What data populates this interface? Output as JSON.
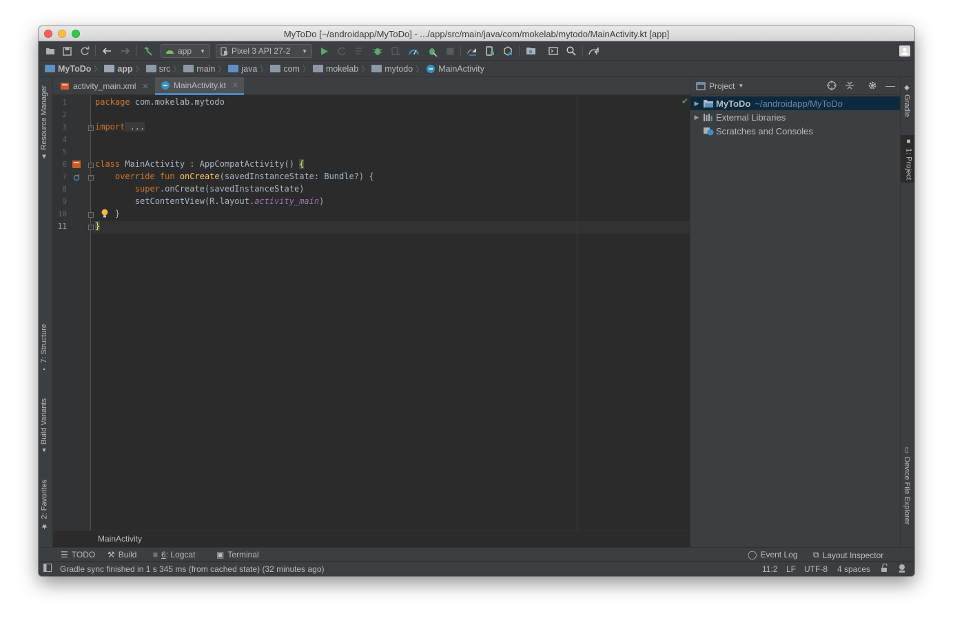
{
  "window": {
    "title": "MyToDo [~/androidapp/MyToDo] - .../app/src/main/java/com/mokelab/mytodo/MainActivity.kt [app]"
  },
  "toolbar": {
    "run_config": "app",
    "device": "Pixel 3 API 27-2"
  },
  "breadcrumb": [
    {
      "label": "MyToDo",
      "bold": true
    },
    {
      "label": "app",
      "bold": true
    },
    {
      "label": "src"
    },
    {
      "label": "main"
    },
    {
      "label": "java"
    },
    {
      "label": "com"
    },
    {
      "label": "mokelab"
    },
    {
      "label": "mytodo"
    },
    {
      "label": "MainActivity"
    }
  ],
  "left_tool_tabs": {
    "resource_manager": "Resource Manager",
    "structure": "7: Structure",
    "build_variants": "Build Variants",
    "favorites": "2: Favorites"
  },
  "right_tool_tabs": {
    "gradle": "Gradle",
    "project": "1: Project",
    "device_file_explorer": "Device File Explorer"
  },
  "editor_tabs": [
    {
      "label": "activity_main.xml",
      "active": false
    },
    {
      "label": "MainActivity.kt",
      "active": true
    }
  ],
  "editor": {
    "line_numbers": [
      "1",
      "2",
      "3",
      "4",
      "5",
      "6",
      "7",
      "8",
      "9",
      "10",
      "11"
    ],
    "current_line": "11",
    "code": {
      "l1_kw": "package",
      "l1_rest": " com.mokelab.mytodo",
      "l3_kw": "import",
      "l3_rest": " ...",
      "l6_kw": "class",
      "l6_rest": " MainActivity : AppCompatActivity() ",
      "l6_brace": "{",
      "l7_kw": "    override fun ",
      "l7_fn": "onCreate",
      "l7_rest": "(savedInstanceState: Bundle?) {",
      "l8_kw": "        super",
      "l8_rest": ".onCreate(savedInstanceState)",
      "l9_rest": "        setContentView(R.layout.",
      "l9_it": "activity_main",
      "l9_end": ")",
      "l10": "    }",
      "l11": "}"
    },
    "footer_breadcrumb": "MainActivity"
  },
  "project_panel": {
    "view_selector": "Project",
    "items": [
      {
        "label": "MyToDo",
        "path": "~/androidapp/MyToDo"
      },
      {
        "label": "External Libraries"
      },
      {
        "label": "Scratches and Consoles"
      }
    ]
  },
  "bottom_tools": {
    "todo": "TODO",
    "build": "Build",
    "logcat_num": "6",
    "logcat": ": Logcat",
    "terminal": "Terminal",
    "event_log": "Event Log",
    "layout_inspector": "Layout Inspector"
  },
  "status": {
    "message": "Gradle sync finished in 1 s 345 ms (from cached state) (32 minutes ago)",
    "position": "11:2",
    "line_sep": "LF",
    "encoding": "UTF-8",
    "indent": "4 spaces"
  },
  "colors": {
    "accent": "#4a88c7",
    "keyword": "#cc7832",
    "function": "#ffc66d",
    "field": "#9876aa",
    "run_green": "#59a869",
    "selection": "#0d293e"
  }
}
